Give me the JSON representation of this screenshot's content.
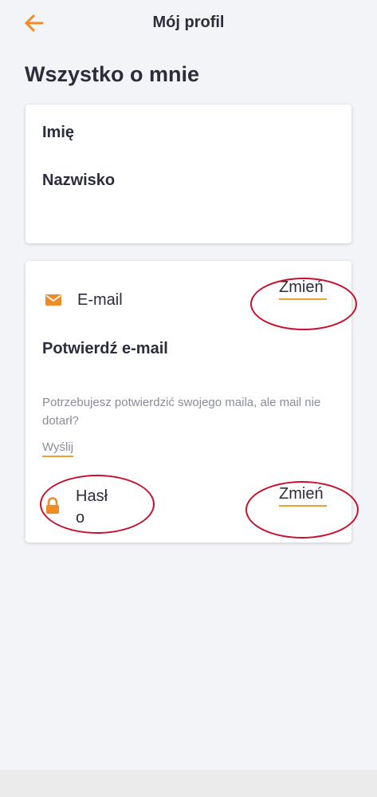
{
  "header": {
    "title": "Mój profil",
    "back_icon": "arrow-left-icon"
  },
  "section": {
    "title": "Wszystko o mnie"
  },
  "personal": {
    "first_name_label": "Imię",
    "last_name_label": "Nazwisko"
  },
  "email": {
    "icon": "envelope-icon",
    "label": "E-mail",
    "change_label": "Zmień",
    "confirm_label": "Potwierdź e-mail",
    "hint": "Potrzebujesz potwierdzić swojego maila, ale mail nie dotarł?",
    "send_label": "Wyślij"
  },
  "password": {
    "icon": "lock-icon",
    "label": "Hasło",
    "change_label": "Zmień"
  },
  "colors": {
    "accent": "#f08a24",
    "underline": "#f0a030",
    "annotation": "#c8102e",
    "background": "#f3f4f8",
    "text": "#2b2d3c",
    "muted": "#8a8d99"
  }
}
